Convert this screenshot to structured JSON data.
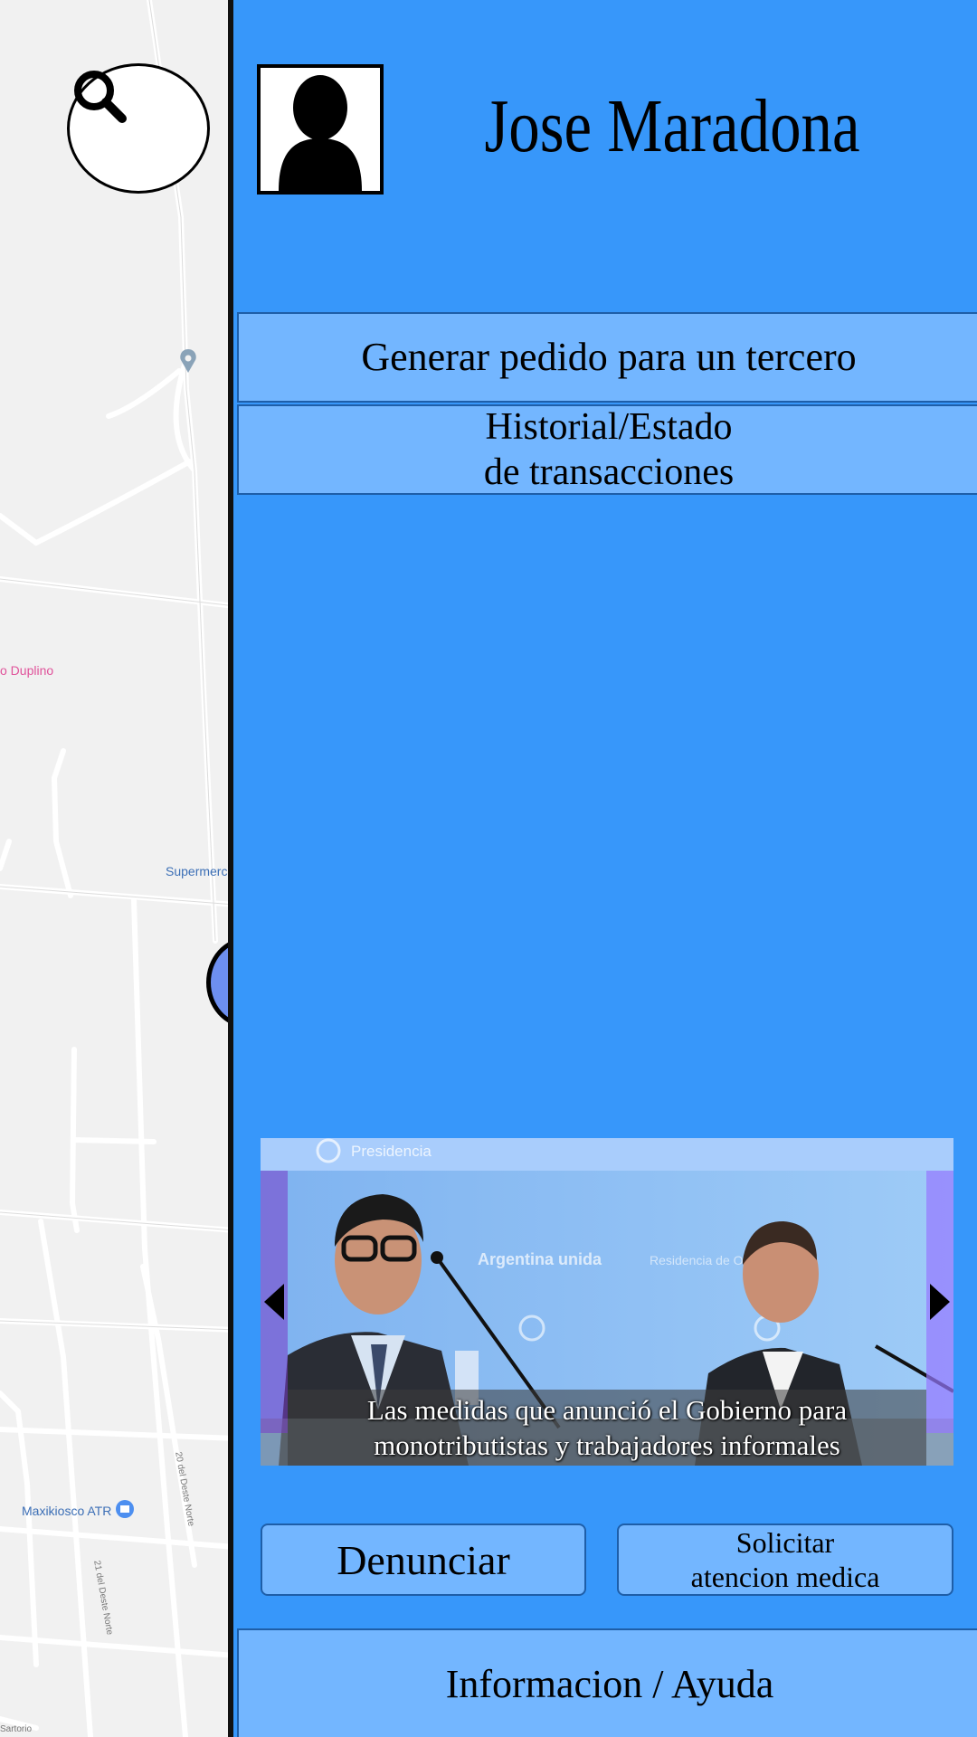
{
  "map": {
    "labels": {
      "duplino": "o Duplino",
      "supermercado": "Supermerc",
      "maxikiosco": "Maxikiosco ATR",
      "street_1": "20 del Deste Norte",
      "street_2": "21 del Deste Norte",
      "sartorio": "Sartorio"
    },
    "search_icon": "search-icon",
    "location_pin_icon": "map-pin-icon"
  },
  "drawer": {
    "user_name": "Jose Maradona",
    "avatar_icon": "user-silhouette-icon",
    "menu": [
      {
        "label": "Generar pedido para un tercero"
      },
      {
        "label": "Historial/Estado\nde transacciones"
      }
    ],
    "news": {
      "caption": "Las medidas que anunció el Gobierno para\nmonotributistas y trabajadores informales",
      "photo_banner_text": "Presidencia",
      "photo_backdrop_texts": [
        "Argentina unida",
        "Residencia de Olivos"
      ],
      "prev_icon": "chevron-left-icon",
      "next_icon": "chevron-right-icon"
    },
    "actions": {
      "denunciar": "Denunciar",
      "solicitar": "Solicitar\natencion medica"
    },
    "footer": "Informacion / Ayuda"
  },
  "colors": {
    "drawer_bg": "#3797fa",
    "button_bg": "#73b6ff",
    "button_border": "#1e5ea8"
  }
}
